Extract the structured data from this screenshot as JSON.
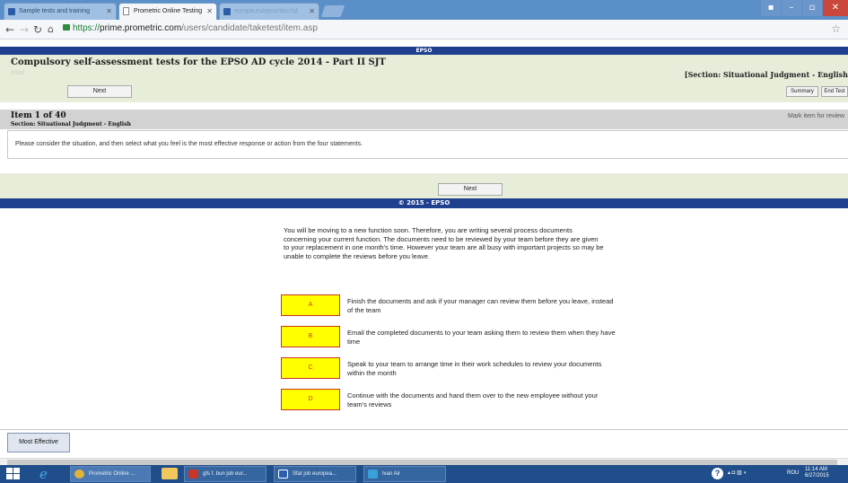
{
  "browser": {
    "tabs": [
      {
        "label": "Sample tests and training"
      },
      {
        "label": "Prometric Online Testing"
      },
      {
        "label": "europa.eu/epso/doc/sjt"
      }
    ],
    "url": {
      "scheme": "https://",
      "host": "prime.prometric.com",
      "path": "/users/candidate/taketest/item.asp"
    }
  },
  "page": {
    "top_bar": "EPSO",
    "title": "Compulsory self-assessment tests for the EPSO AD cycle 2014 - Part II SJT",
    "subtitle_faded": "0000",
    "section_label": "[Section: Situational Judgment - English",
    "next_label": "Next",
    "summary_label": "Summary",
    "end_test_label": "End Test",
    "item_number": "Item 1 of 40",
    "item_section": "Section: Situational Judgment - English",
    "mark_review": "Mark item for review",
    "instructions": "Please consider the situation, and then select what you feel is the most effective response or action from the four statements.",
    "next_bottom_label": "Next",
    "copyright": "© 2015 - EPSO"
  },
  "question": {
    "scenario": "You will be moving to a new function soon. Therefore, you are writing several process documents concerning your current function. The documents need to be reviewed by your team before they are given to your replacement in one month's time. However your team are all busy with important projects so may be unable to complete the reviews before you leave.",
    "options": [
      {
        "letter": "A",
        "text": "Finish the documents and ask if your manager can review them before you leave, instead of the team"
      },
      {
        "letter": "B",
        "text": "Email the completed documents to your team asking them to review them when they have time"
      },
      {
        "letter": "C",
        "text": "Speak to your team to arrange time in their work schedules to review your documents within the month"
      },
      {
        "letter": "D",
        "text": "Continue with the documents and hand them over to the new employee without your team's reviews"
      }
    ],
    "answer_button": "Most Effective"
  },
  "taskbar": {
    "items": [
      {
        "label": "Prometric Online ...",
        "icon": "chrome-icon"
      },
      {
        "label": "gfs f. bun job eur...",
        "icon": "pdf-icon"
      },
      {
        "label": "Sfat job europea...",
        "icon": "word-icon"
      },
      {
        "label": "Ivan Air",
        "icon": "3g-icon"
      }
    ],
    "lang": "ROU",
    "time": "11:14 AM",
    "date": "6/27/2015"
  }
}
